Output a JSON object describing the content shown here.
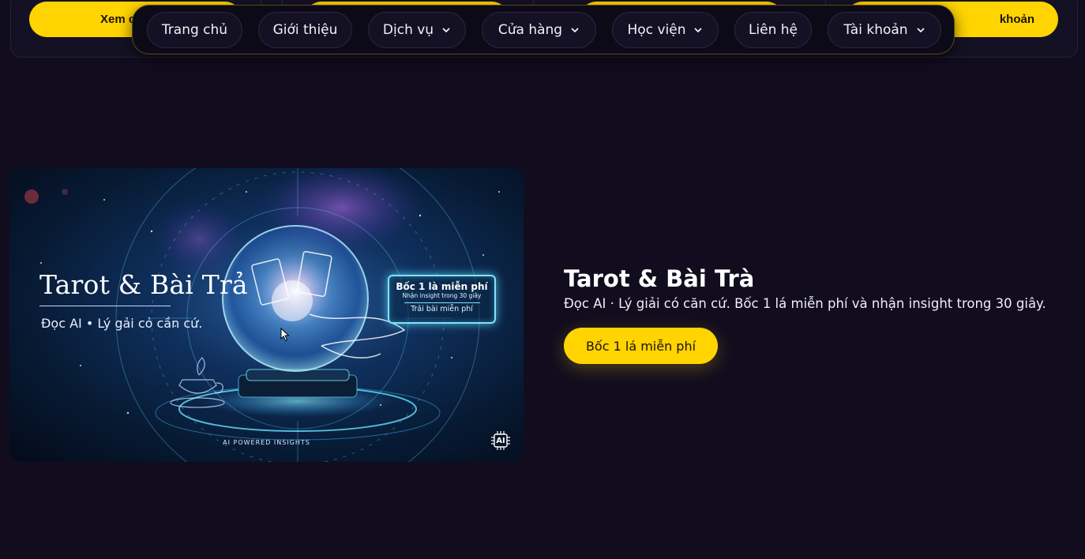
{
  "background_buttons": {
    "left_label": "Xem c",
    "right_label": "khoản"
  },
  "nav": {
    "items": [
      {
        "label": "Trang chủ",
        "has_dropdown": false
      },
      {
        "label": "Giới thiệu",
        "has_dropdown": false
      },
      {
        "label": "Dịch vụ",
        "has_dropdown": true
      },
      {
        "label": "Cửa hàng",
        "has_dropdown": true
      },
      {
        "label": "Học viện",
        "has_dropdown": true
      },
      {
        "label": "Liên hệ",
        "has_dropdown": false
      },
      {
        "label": "Tài khoản",
        "has_dropdown": true
      }
    ]
  },
  "hero": {
    "image": {
      "title": "Tarot & Bài Trả",
      "subtitle": "Đọc AI • Lý gải cỏ cần cứ.",
      "badge_title": "Bốc 1 là miễn phí",
      "badge_line2": "Nhận insight trong 30 giây",
      "badge_line3": "Trải bài miễn phí",
      "footer": "AI POWERED INSIGHTS",
      "chip_label": "AI",
      "chip_icon": "ai-chip-icon"
    },
    "title": "Tarot & Bài Trà",
    "description": "Đọc AI · Lý giải có căn cứ. Bốc 1 lá miễn phí và nhận insight trong 30 giây.",
    "cta_label": "Bốc 1 lá miễn phí"
  },
  "colors": {
    "background": "#110d1e",
    "accent": "#ffd400",
    "nav_border": "#5b4a18",
    "glow": "#7ee3ff"
  }
}
